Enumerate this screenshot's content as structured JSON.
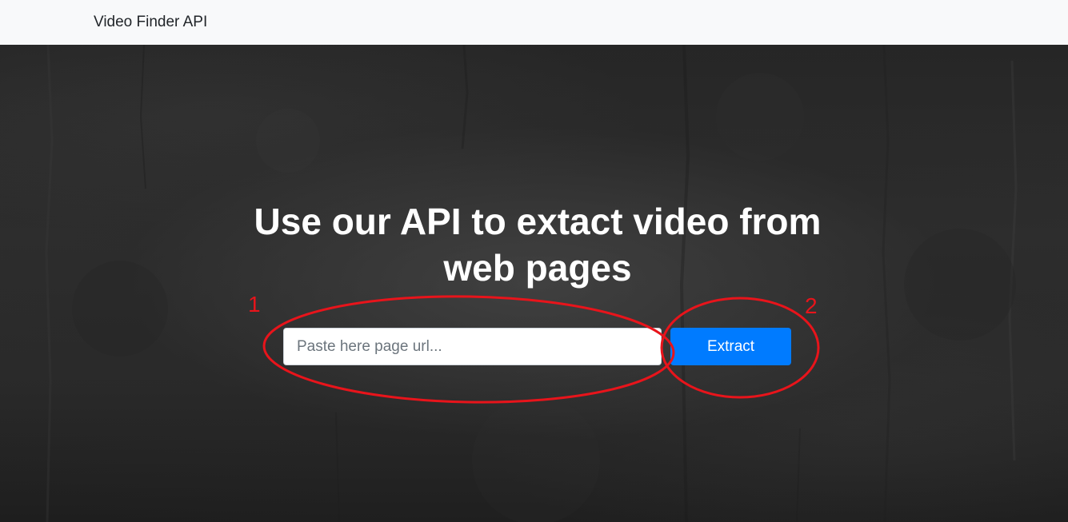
{
  "navbar": {
    "brand": "Video Finder API"
  },
  "hero": {
    "headline": "Use our API to extact video from web pages",
    "input_placeholder": "Paste here page url...",
    "input_value": "",
    "button_label": "Extract"
  },
  "annotations": [
    {
      "label": "1",
      "target": "url-input"
    },
    {
      "label": "2",
      "target": "extract-button"
    }
  ],
  "colors": {
    "navbar_bg": "#f8f9fa",
    "button_bg": "#007bff",
    "annotation": "#e8141b"
  }
}
